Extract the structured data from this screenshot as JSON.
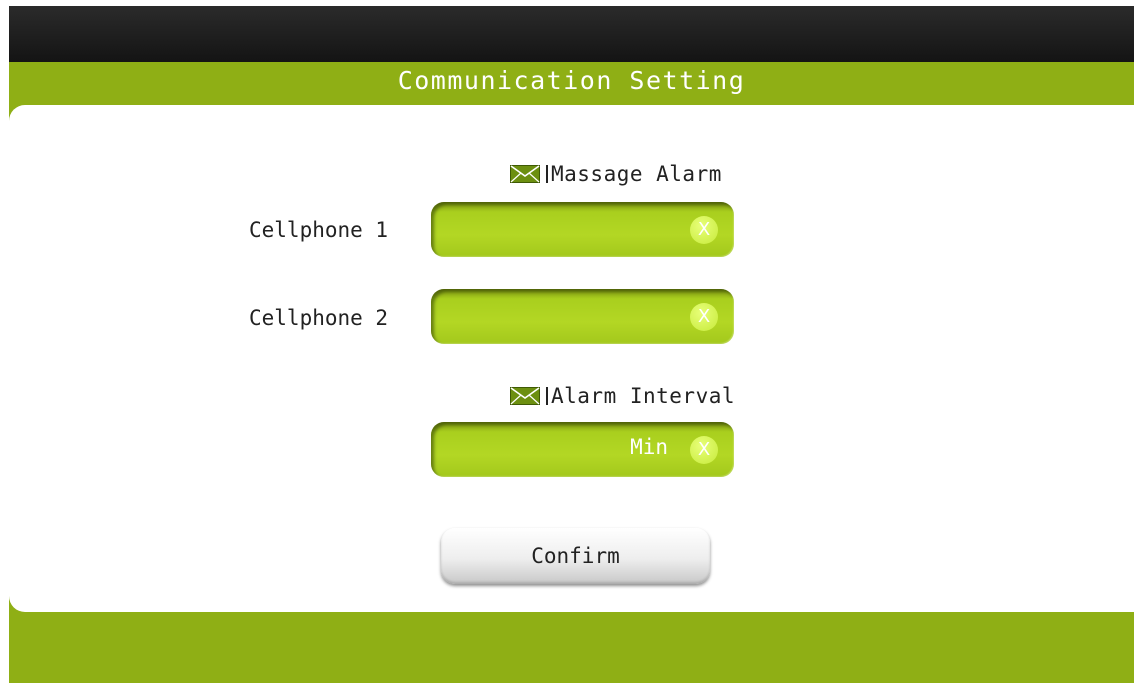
{
  "header": {
    "title": "Communication Setting"
  },
  "message_alarm": {
    "heading_icon": "envelope-icon",
    "heading": "Massage Alarm",
    "fields": [
      {
        "label": "Cellphone 1",
        "value": "",
        "clear_label": "X"
      },
      {
        "label": "Cellphone 2",
        "value": "",
        "clear_label": "X"
      }
    ]
  },
  "alarm_interval": {
    "heading_icon": "envelope-icon",
    "heading": "Alarm Interval",
    "value": "",
    "unit": "Min",
    "clear_label": "X"
  },
  "actions": {
    "confirm_label": "Confirm"
  },
  "colors": {
    "accent_green": "#8faf15",
    "field_green": "#b3d724",
    "top_bar": "#1b1b1b"
  }
}
